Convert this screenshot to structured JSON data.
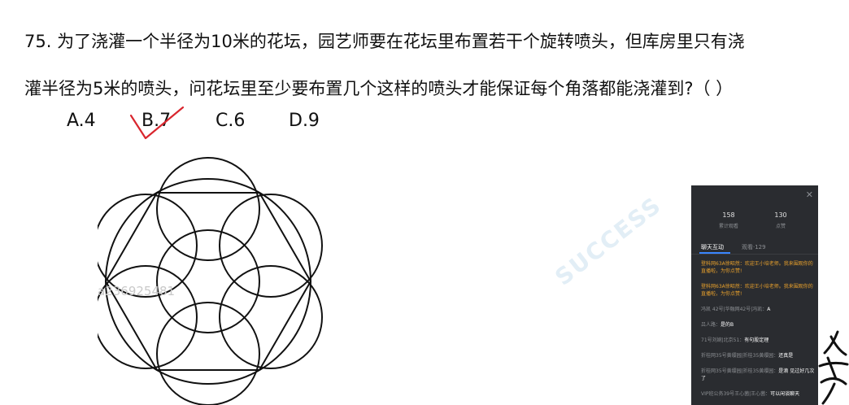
{
  "question": {
    "number": "75.",
    "line1": "为了浇灌一个半径为10米的花坛，园艺师要在花坛里布置若干个旋转喷头，但库房里只有浇",
    "line2": "灌半径为5米的喷头，问花坛里至少要布置几个这样的喷头才能保证每个角落都能浇灌到?（ ）"
  },
  "options": [
    {
      "label": "A.4"
    },
    {
      "label": "B.7",
      "checked": true
    },
    {
      "label": "C.6"
    },
    {
      "label": "D.9"
    }
  ],
  "check_color": "#d9262e",
  "watermark": {
    "id": "a236925481",
    "diagonal": "SUCCESS"
  },
  "chat": {
    "stats": [
      {
        "value": "158",
        "label": "累计观看"
      },
      {
        "value": "130",
        "label": "点赞"
      }
    ],
    "tabs": [
      {
        "label": "聊天互动"
      },
      {
        "label": "观看·129"
      }
    ],
    "messages": [
      {
        "who": "登科网63A徐昭然：",
        "text": "欢迎王小培老师。我来围观你的直播啦，为你点赞!",
        "system": true
      },
      {
        "who": "登科网63A徐昭然：",
        "text": "欢迎王小培老师。我来围观你的直播啦，为你点赞!",
        "system": true
      },
      {
        "who": "冯凯 42号|华融网42号|冯凯：",
        "text": "A",
        "system": false
      },
      {
        "who": "吕人路：",
        "text": "是的B",
        "system": false
      },
      {
        "who": "71号刘婉|北京51：",
        "text": "有句股定理",
        "system": false
      },
      {
        "who": "折桂网35号黄缨园|折桂35黄缨园：",
        "text": "还真是",
        "system": false
      },
      {
        "who": "折桂网35号黄缨园|折桂35黄缨园：",
        "text": "是滴 见过好几次了",
        "system": false
      },
      {
        "who": "VIP班公务39号王心菌|王心菌：",
        "text": "可以闲谈聊天",
        "system": false
      }
    ]
  },
  "accent_color": "#3a86ff",
  "panel_bg": "#2a2c30",
  "icons": {
    "close": "close-icon",
    "check": "check-mark-icon"
  }
}
